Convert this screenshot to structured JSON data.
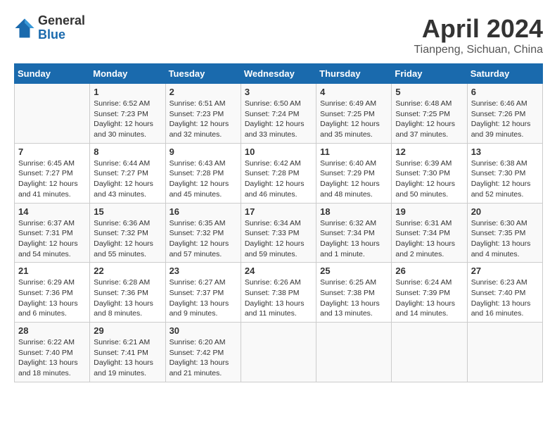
{
  "header": {
    "logo_general": "General",
    "logo_blue": "Blue",
    "month_title": "April 2024",
    "location": "Tianpeng, Sichuan, China"
  },
  "calendar": {
    "days_of_week": [
      "Sunday",
      "Monday",
      "Tuesday",
      "Wednesday",
      "Thursday",
      "Friday",
      "Saturday"
    ],
    "weeks": [
      [
        {
          "day": "",
          "info": ""
        },
        {
          "day": "1",
          "info": "Sunrise: 6:52 AM\nSunset: 7:23 PM\nDaylight: 12 hours\nand 30 minutes."
        },
        {
          "day": "2",
          "info": "Sunrise: 6:51 AM\nSunset: 7:23 PM\nDaylight: 12 hours\nand 32 minutes."
        },
        {
          "day": "3",
          "info": "Sunrise: 6:50 AM\nSunset: 7:24 PM\nDaylight: 12 hours\nand 33 minutes."
        },
        {
          "day": "4",
          "info": "Sunrise: 6:49 AM\nSunset: 7:25 PM\nDaylight: 12 hours\nand 35 minutes."
        },
        {
          "day": "5",
          "info": "Sunrise: 6:48 AM\nSunset: 7:25 PM\nDaylight: 12 hours\nand 37 minutes."
        },
        {
          "day": "6",
          "info": "Sunrise: 6:46 AM\nSunset: 7:26 PM\nDaylight: 12 hours\nand 39 minutes."
        }
      ],
      [
        {
          "day": "7",
          "info": "Sunrise: 6:45 AM\nSunset: 7:27 PM\nDaylight: 12 hours\nand 41 minutes."
        },
        {
          "day": "8",
          "info": "Sunrise: 6:44 AM\nSunset: 7:27 PM\nDaylight: 12 hours\nand 43 minutes."
        },
        {
          "day": "9",
          "info": "Sunrise: 6:43 AM\nSunset: 7:28 PM\nDaylight: 12 hours\nand 45 minutes."
        },
        {
          "day": "10",
          "info": "Sunrise: 6:42 AM\nSunset: 7:28 PM\nDaylight: 12 hours\nand 46 minutes."
        },
        {
          "day": "11",
          "info": "Sunrise: 6:40 AM\nSunset: 7:29 PM\nDaylight: 12 hours\nand 48 minutes."
        },
        {
          "day": "12",
          "info": "Sunrise: 6:39 AM\nSunset: 7:30 PM\nDaylight: 12 hours\nand 50 minutes."
        },
        {
          "day": "13",
          "info": "Sunrise: 6:38 AM\nSunset: 7:30 PM\nDaylight: 12 hours\nand 52 minutes."
        }
      ],
      [
        {
          "day": "14",
          "info": "Sunrise: 6:37 AM\nSunset: 7:31 PM\nDaylight: 12 hours\nand 54 minutes."
        },
        {
          "day": "15",
          "info": "Sunrise: 6:36 AM\nSunset: 7:32 PM\nDaylight: 12 hours\nand 55 minutes."
        },
        {
          "day": "16",
          "info": "Sunrise: 6:35 AM\nSunset: 7:32 PM\nDaylight: 12 hours\nand 57 minutes."
        },
        {
          "day": "17",
          "info": "Sunrise: 6:34 AM\nSunset: 7:33 PM\nDaylight: 12 hours\nand 59 minutes."
        },
        {
          "day": "18",
          "info": "Sunrise: 6:32 AM\nSunset: 7:34 PM\nDaylight: 13 hours\nand 1 minute."
        },
        {
          "day": "19",
          "info": "Sunrise: 6:31 AM\nSunset: 7:34 PM\nDaylight: 13 hours\nand 2 minutes."
        },
        {
          "day": "20",
          "info": "Sunrise: 6:30 AM\nSunset: 7:35 PM\nDaylight: 13 hours\nand 4 minutes."
        }
      ],
      [
        {
          "day": "21",
          "info": "Sunrise: 6:29 AM\nSunset: 7:36 PM\nDaylight: 13 hours\nand 6 minutes."
        },
        {
          "day": "22",
          "info": "Sunrise: 6:28 AM\nSunset: 7:36 PM\nDaylight: 13 hours\nand 8 minutes."
        },
        {
          "day": "23",
          "info": "Sunrise: 6:27 AM\nSunset: 7:37 PM\nDaylight: 13 hours\nand 9 minutes."
        },
        {
          "day": "24",
          "info": "Sunrise: 6:26 AM\nSunset: 7:38 PM\nDaylight: 13 hours\nand 11 minutes."
        },
        {
          "day": "25",
          "info": "Sunrise: 6:25 AM\nSunset: 7:38 PM\nDaylight: 13 hours\nand 13 minutes."
        },
        {
          "day": "26",
          "info": "Sunrise: 6:24 AM\nSunset: 7:39 PM\nDaylight: 13 hours\nand 14 minutes."
        },
        {
          "day": "27",
          "info": "Sunrise: 6:23 AM\nSunset: 7:40 PM\nDaylight: 13 hours\nand 16 minutes."
        }
      ],
      [
        {
          "day": "28",
          "info": "Sunrise: 6:22 AM\nSunset: 7:40 PM\nDaylight: 13 hours\nand 18 minutes."
        },
        {
          "day": "29",
          "info": "Sunrise: 6:21 AM\nSunset: 7:41 PM\nDaylight: 13 hours\nand 19 minutes."
        },
        {
          "day": "30",
          "info": "Sunrise: 6:20 AM\nSunset: 7:42 PM\nDaylight: 13 hours\nand 21 minutes."
        },
        {
          "day": "",
          "info": ""
        },
        {
          "day": "",
          "info": ""
        },
        {
          "day": "",
          "info": ""
        },
        {
          "day": "",
          "info": ""
        }
      ]
    ]
  }
}
